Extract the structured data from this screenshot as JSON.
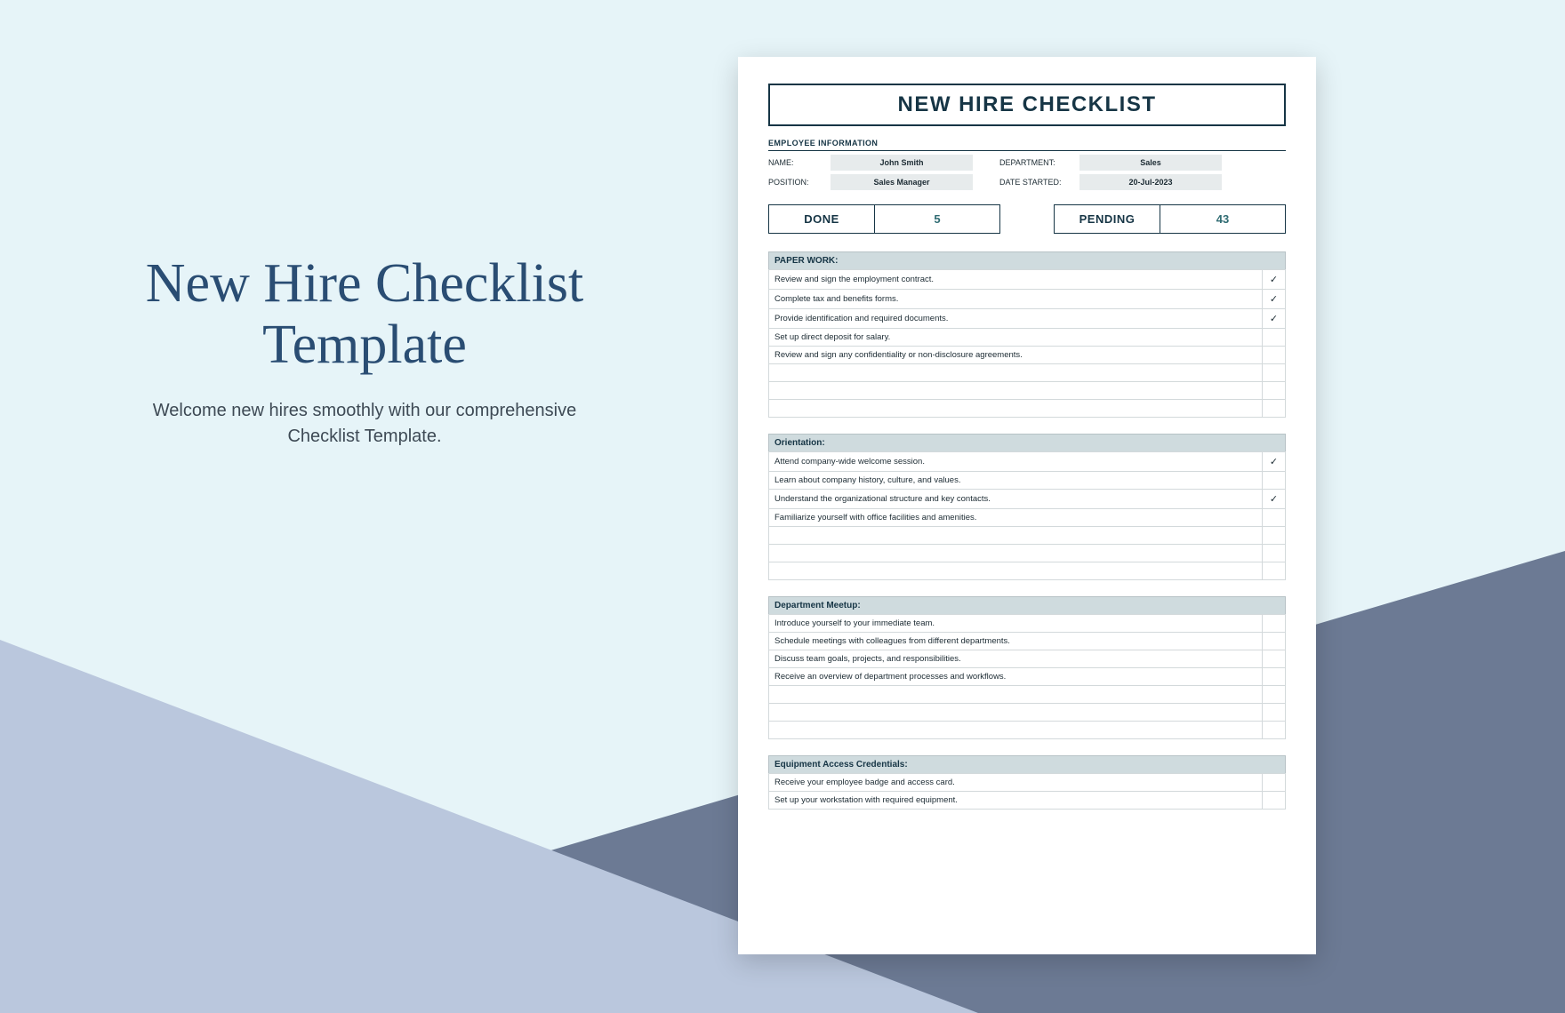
{
  "headline": {
    "title": "New Hire Checklist Template",
    "subtitle": "Welcome new hires smoothly with our comprehensive Checklist Template."
  },
  "doc": {
    "title": "NEW HIRE CHECKLIST",
    "empInfoLabel": "EMPLOYEE INFORMATION",
    "fields": {
      "nameLabel": "NAME:",
      "nameValue": "John Smith",
      "deptLabel": "DEPARTMENT:",
      "deptValue": "Sales",
      "positionLabel": "POSITION:",
      "positionValue": "Sales Manager",
      "dateLabel": "DATE STARTED:",
      "dateValue": "20-Jul-2023"
    },
    "status": {
      "doneLabel": "DONE",
      "doneValue": "5",
      "pendingLabel": "PENDING",
      "pendingValue": "43"
    },
    "sections": [
      {
        "title": "PAPER WORK:",
        "rows": [
          {
            "text": "Review and sign the employment contract.",
            "check": "✓"
          },
          {
            "text": "Complete tax and benefits forms.",
            "check": "✓"
          },
          {
            "text": "Provide identification and required documents.",
            "check": "✓"
          },
          {
            "text": "Set up direct deposit for salary.",
            "check": ""
          },
          {
            "text": "Review and sign any confidentiality or non-disclosure agreements.",
            "check": ""
          },
          {
            "text": "",
            "check": ""
          },
          {
            "text": "",
            "check": ""
          },
          {
            "text": "",
            "check": ""
          }
        ]
      },
      {
        "title": "Orientation:",
        "rows": [
          {
            "text": "Attend company-wide welcome session.",
            "check": "✓"
          },
          {
            "text": "Learn about company history, culture, and values.",
            "check": ""
          },
          {
            "text": "Understand the organizational structure and key contacts.",
            "check": "✓"
          },
          {
            "text": "Familiarize yourself with office facilities and amenities.",
            "check": ""
          },
          {
            "text": "",
            "check": ""
          },
          {
            "text": "",
            "check": ""
          },
          {
            "text": "",
            "check": ""
          }
        ]
      },
      {
        "title": "Department Meetup:",
        "rows": [
          {
            "text": "Introduce yourself to your immediate team.",
            "check": ""
          },
          {
            "text": "Schedule meetings with colleagues from different departments.",
            "check": ""
          },
          {
            "text": "Discuss team goals, projects, and responsibilities.",
            "check": ""
          },
          {
            "text": "Receive an overview of department processes and workflows.",
            "check": ""
          },
          {
            "text": "",
            "check": ""
          },
          {
            "text": "",
            "check": ""
          },
          {
            "text": "",
            "check": ""
          }
        ]
      },
      {
        "title": "Equipment Access Credentials:",
        "rows": [
          {
            "text": "Receive your employee badge and access card.",
            "check": ""
          },
          {
            "text": "Set up your workstation with required equipment.",
            "check": ""
          }
        ]
      }
    ]
  }
}
